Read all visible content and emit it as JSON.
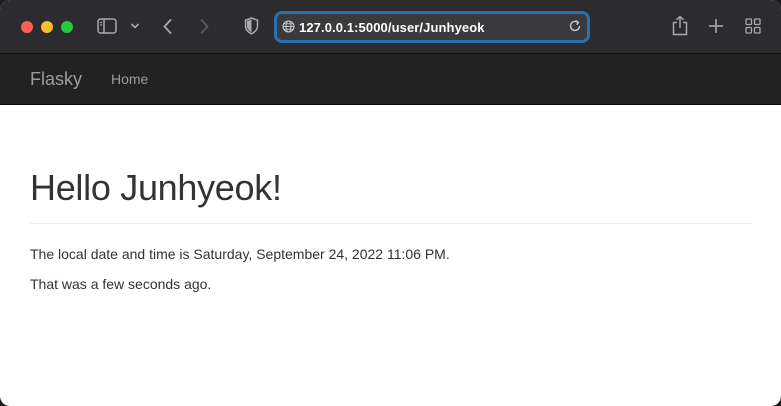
{
  "browser": {
    "url": "127.0.0.1:5000/user/Junhyeok",
    "icons": {
      "sidebar": "sidebar-icon",
      "chevron": "chevron-down-icon",
      "back": "back-arrow-icon",
      "forward": "forward-arrow-icon",
      "shield": "privacy-shield-icon",
      "globe": "globe-icon",
      "reload": "reload-icon",
      "share": "share-icon",
      "new_tab": "plus-icon",
      "tab_overview": "tab-grid-icon"
    }
  },
  "navbar": {
    "brand": "Flasky",
    "items": [
      {
        "label": "Home"
      }
    ]
  },
  "main": {
    "heading": "Hello Junhyeok!",
    "paragraphs": [
      "The local date and time is Saturday, September 24, 2022 11:06 PM.",
      "That was a few seconds ago."
    ]
  },
  "colors": {
    "navbar_bg": "#222222",
    "nav_text": "#9d9d9d",
    "heading_text": "#333333",
    "url_focus_ring": "#2a6fb0"
  }
}
